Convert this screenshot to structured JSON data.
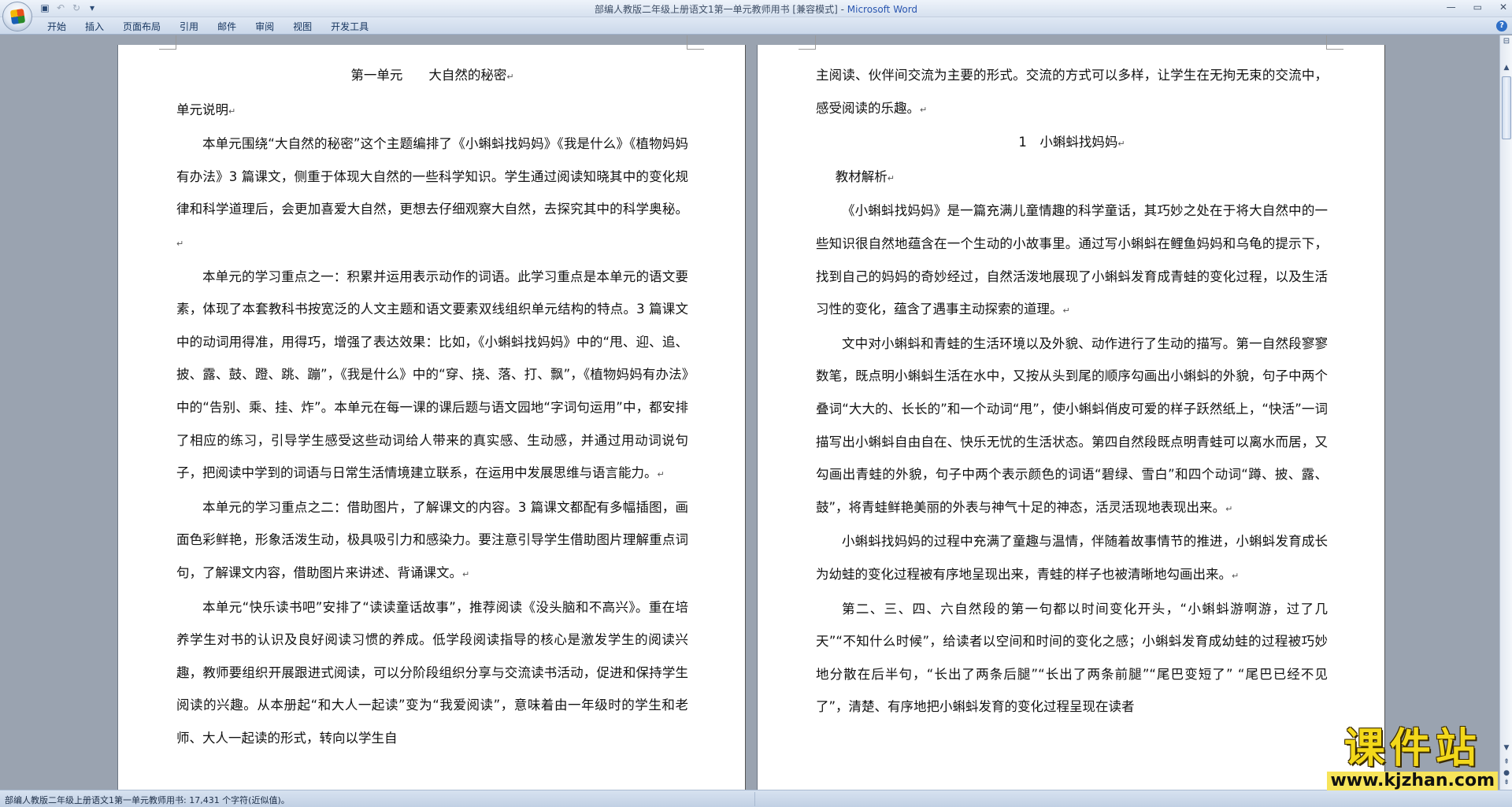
{
  "window": {
    "title": "部编人教版二年级上册语文1第一单元教师用书 [兼容模式]",
    "app_name": "Microsoft Word"
  },
  "ribbon": {
    "tabs": [
      "开始",
      "插入",
      "页面布局",
      "引用",
      "邮件",
      "审阅",
      "视图",
      "开发工具"
    ]
  },
  "left_page": {
    "heading": "第一单元　　大自然的秘密",
    "subheading": "单元说明",
    "paragraphs": [
      "本单元围绕“大自然的秘密”这个主题编排了《小蝌蚪找妈妈》《我是什么》《植物妈妈有办法》3 篇课文，侧重于体现大自然的一些科学知识。学生通过阅读知晓其中的变化规律和科学道理后，会更加喜爱大自然，更想去仔细观察大自然，去探究其中的科学奥秘。",
      "本单元的学习重点之一：积累并运用表示动作的词语。此学习重点是本单元的语文要素，体现了本套教科书按宽泛的人文主题和语文要素双线组织单元结构的特点。3 篇课文中的动词用得准，用得巧，增强了表达效果：比如，《小蝌蚪找妈妈》中的“甩、迎、追、披、露、鼓、蹬、跳、蹦”，《我是什么》中的“穿、挠、落、打、飘”，《植物妈妈有办法》中的“告别、乘、挂、炸”。本单元在每一课的课后题与语文园地“字词句运用”中，都安排了相应的练习，引导学生感受这些动词给人带来的真实感、生动感，并通过用动词说句子，把阅读中学到的词语与日常生活情境建立联系，在运用中发展思维与语言能力。",
      "本单元的学习重点之二：借助图片，了解课文的内容。3 篇课文都配有多幅插图，画面色彩鲜艳，形象活泼生动，极具吸引力和感染力。要注意引导学生借助图片理解重点词句，了解课文内容，借助图片来讲述、背诵课文。",
      "本单元“快乐读书吧”安排了“读读童话故事”，推荐阅读《没头脑和不高兴》。重在培养学生对书的认识及良好阅读习惯的养成。低学段阅读指导的核心是激发学生的阅读兴趣，教师要组织开展跟进式阅读，可以分阶段组织分享与交流读书活动，促进和保持学生阅读的兴趣。从本册起“和大人一起读”变为“我爱阅读”，意味着由一年级时的学生和老师、大人一起读的形式，转向以学生自"
    ]
  },
  "right_page": {
    "continued": "主阅读、伙伴间交流为主要的形式。交流的方式可以多样，让学生在无拘无束的交流中，感受阅读的乐趣。",
    "lesson_title": "1　小蝌蚪找妈妈",
    "section_title": "教材解析",
    "paragraphs": [
      "《小蝌蚪找妈妈》是一篇充满儿童情趣的科学童话，其巧妙之处在于将大自然中的一些知识很自然地蕴含在一个生动的小故事里。通过写小蝌蚪在鲤鱼妈妈和乌龟的提示下，找到自己的妈妈的奇妙经过，自然活泼地展现了小蝌蚪发育成青蛙的变化过程，以及生活习性的变化，蕴含了遇事主动探索的道理。",
      "文中对小蝌蚪和青蛙的生活环境以及外貌、动作进行了生动的描写。第一自然段寥寥数笔，既点明小蝌蚪生活在水中，又按从头到尾的顺序勾画出小蝌蚪的外貌，句子中两个叠词“大大的、长长的”和一个动词“甩”，使小蝌蚪俏皮可爱的样子跃然纸上，“快活”一词描写出小蝌蚪自由自在、快乐无忧的生活状态。第四自然段既点明青蛙可以离水而居，又勾画出青蛙的外貌，句子中两个表示颜色的词语“碧绿、雪白”和四个动词“蹲、披、露、鼓”，将青蛙鲜艳美丽的外表与神气十足的神态，活灵活现地表现出来。",
      "小蝌蚪找妈妈的过程中充满了童趣与温情，伴随着故事情节的推进，小蝌蚪发育成长为幼蛙的变化过程被有序地呈现出来，青蛙的样子也被清晰地勾画出来。",
      "第二、三、四、六自然段的第一句都以时间变化开头，“小蝌蚪游啊游，过了几天”“不知什么时候”，给读者以空间和时间的变化之感；小蝌蚪发育成幼蛙的过程被巧妙地分散在后半句，“长出了两条后腿”“长出了两条前腿”“尾巴变短了” “尾巴已经不见了”，清楚、有序地把小蝌蚪发育的变化过程呈现在读者"
    ]
  },
  "status_bar": {
    "text": "部编人教版二年级上册语文1第一单元教师用书: 17,431 个字符(近似值)。"
  },
  "watermark": {
    "title": "课件站",
    "url": "www.kjzhan.com"
  },
  "paragraph_mark": "↵"
}
